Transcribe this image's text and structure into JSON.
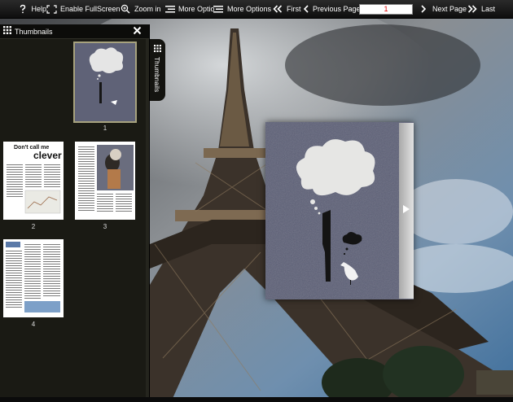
{
  "toolbar": {
    "help": {
      "label": "Help",
      "icon": "help-icon"
    },
    "fullscreen": {
      "label": "Enable FullScreen",
      "icon": "fullscreen-icon"
    },
    "zoom": {
      "label": "Zoom in",
      "icon": "zoom-in-icon"
    },
    "more_options_1": {
      "label": "More Optio",
      "icon": "list-icon"
    },
    "more_options_2": {
      "label": "More Options",
      "icon": "list-icon"
    },
    "first": {
      "label": "First",
      "icon": "double-chevron-left-icon"
    },
    "previous": {
      "label": "Previous Page",
      "icon": "chevron-left-icon"
    },
    "page_input_value": "1",
    "next": {
      "label": "Next Page",
      "icon": "chevron-right-icon"
    },
    "last": {
      "label": "Last",
      "icon": "double-chevron-right-icon"
    }
  },
  "thumbnails_panel": {
    "title": "Thumbnails",
    "side_tab_label": "Thumbnails",
    "items": [
      {
        "number": "1",
        "selected": true
      },
      {
        "number": "2",
        "headline_1": "Don't call me",
        "headline_2": "clever"
      },
      {
        "number": "3"
      },
      {
        "number": "4"
      }
    ]
  },
  "colors": {
    "toolbar_bg": "#111111",
    "panel_bg": "#1a1a14",
    "page_input_text": "#dd0000",
    "cover_bg": "#5c5f76",
    "selected_outline": "#a7a27e"
  }
}
